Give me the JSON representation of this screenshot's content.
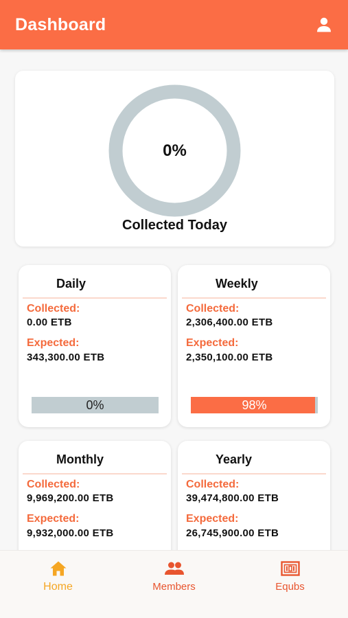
{
  "appbar": {
    "title": "Dashboard",
    "profile_icon": "person-icon"
  },
  "summary": {
    "percent_label": "0%",
    "percent_value": 0,
    "label": "Collected Today"
  },
  "cards": {
    "daily": {
      "title": "Daily",
      "collected_label": "Collected:",
      "collected": "0.00 ETB",
      "expected_label": "Expected:",
      "expected": "343,300.00 ETB",
      "progress_label": "0%",
      "progress_value": 0
    },
    "weekly": {
      "title": "Weekly",
      "collected_label": "Collected:",
      "collected": "2,306,400.00 ETB",
      "expected_label": "Expected:",
      "expected": "2,350,100.00 ETB",
      "progress_label": "98%",
      "progress_value": 98
    },
    "monthly": {
      "title": "Monthly",
      "collected_label": "Collected:",
      "collected": "9,969,200.00 ETB",
      "expected_label": "Expected:",
      "expected": "9,932,000.00 ETB"
    },
    "yearly": {
      "title": "Yearly",
      "collected_label": "Collected:",
      "collected": "39,474,800.00 ETB",
      "expected_label": "Expected:",
      "expected": "26,745,900.00 ETB"
    }
  },
  "nav": {
    "items": [
      {
        "label": "Home",
        "icon": "home-icon",
        "active": true
      },
      {
        "label": "Members",
        "icon": "members-icon",
        "active": false
      },
      {
        "label": "Equbs",
        "icon": "equbs-icon",
        "active": false
      }
    ]
  },
  "colors": {
    "primary": "#fb6d45",
    "accent_label": "#f46a3c",
    "track": "#c1cdd1",
    "nav_active": "#f5a623"
  }
}
